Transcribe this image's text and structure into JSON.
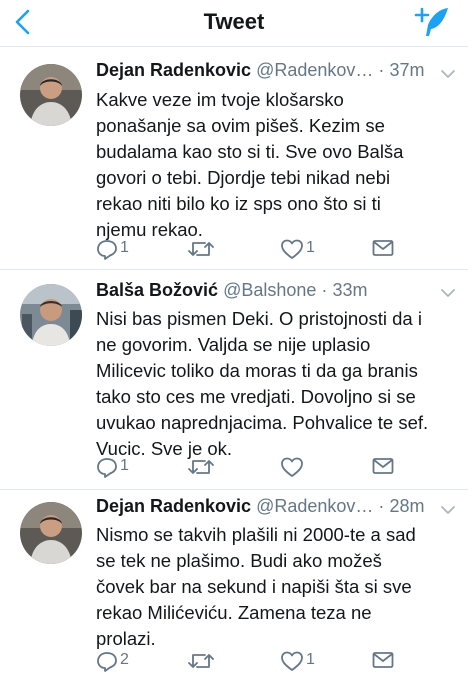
{
  "nav": {
    "title": "Tweet"
  },
  "tweets": [
    {
      "name": "Dejan Radenkovic",
      "handle": "@Radenkov…",
      "sep": "·",
      "time": "37m",
      "lines": [
        "Kakve veze im tvoje klošarsko",
        "ponašanje sa ovim pišeš. Kezim se",
        "budalama kao sto si ti. Sve ovo Balša",
        "govori o tebi. Djordje tebi nikad nebi",
        "rekao niti bilo ko iz sps ono što si ti",
        "njemu rekao."
      ],
      "reply_count": "1",
      "retweet_count": "",
      "like_count": "1"
    },
    {
      "name": "Balša Božović",
      "handle": "@Balshone",
      "sep": "·",
      "time": "33m",
      "lines": [
        "Nisi bas pismen Deki. O pristojnosti da i",
        "ne govorim. Valjda se nije uplasio",
        "Milicevic toliko da moras ti da ga branis",
        "tako sto ces me vredjati. Dovoljno si se",
        "uvukao naprednjacima. Pohvalice te sef.",
        "Vucic. Sve je ok."
      ],
      "reply_count": "1",
      "retweet_count": "",
      "like_count": ""
    },
    {
      "name": "Dejan Radenkovic",
      "handle": "@Radenkov…",
      "sep": "·",
      "time": "28m",
      "lines": [
        "Nismo se takvih plašili ni 2000-te a sad",
        "se tek ne plašimo. Budi ako možeš",
        "čovek bar na sekund i napiši šta si sve",
        "rekao Milićeviću. Zamena teza ne",
        "prolazi."
      ],
      "reply_count": "2",
      "retweet_count": "",
      "like_count": "1"
    }
  ],
  "colors": {
    "accent": "#1da1f2",
    "secondary": "#657786",
    "text": "#14171a",
    "divider": "#e1e8ed"
  }
}
